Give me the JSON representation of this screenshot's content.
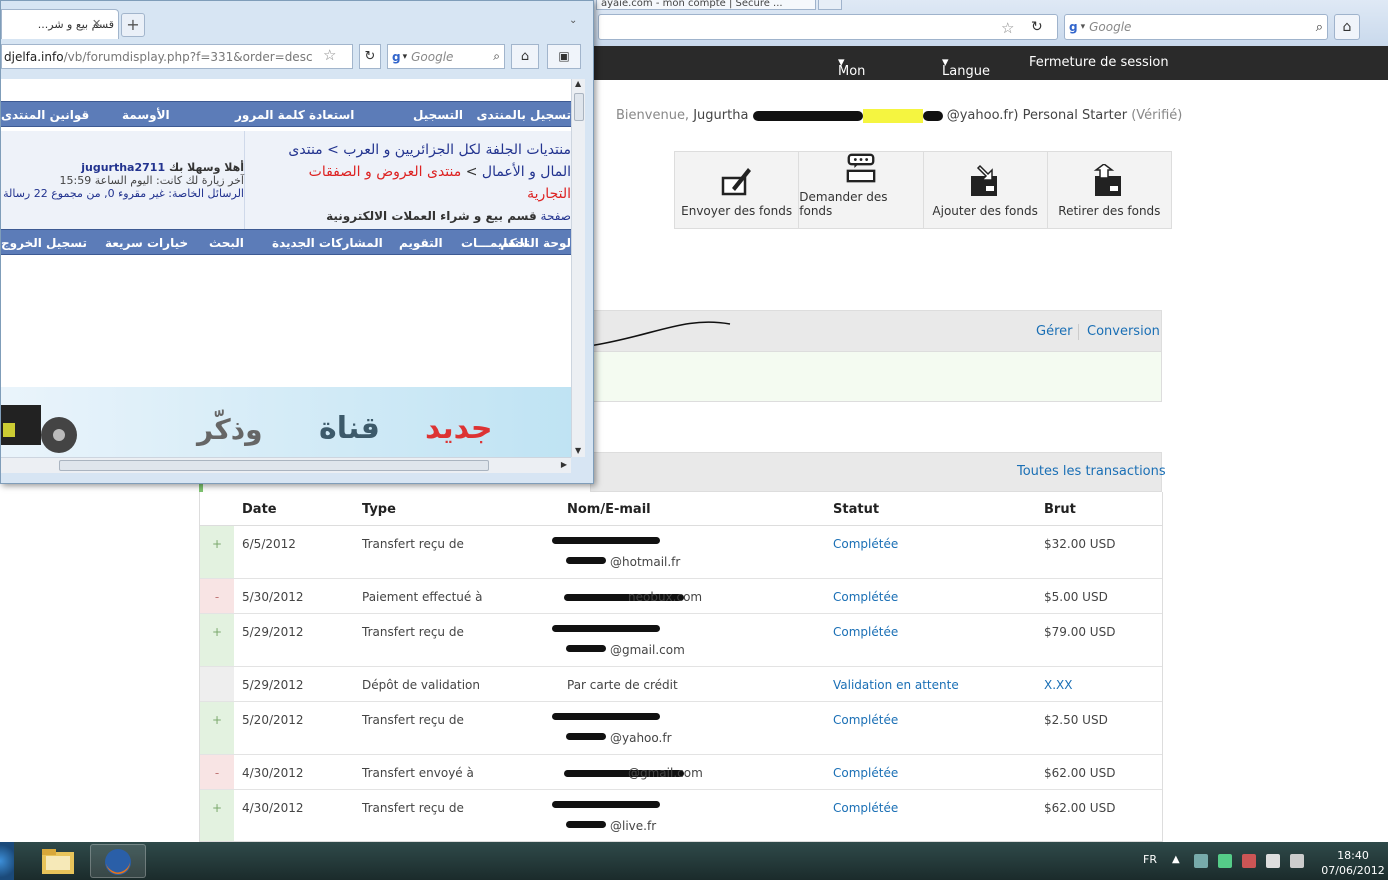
{
  "background_browser": {
    "tab_title": "ayaie.com - mon compte | Sécuré ... ",
    "search_placeholder": "Google",
    "nav": {
      "profile": "Mon profil",
      "language": "Langue",
      "logout": "Fermeture de session"
    },
    "welcome": {
      "prefix": "Bienvenue,",
      "name": "Jugurtha",
      "email_suffix": "@yahoo.fr)",
      "account_type": "Personal Starter",
      "verified": "(Vérifié)"
    },
    "actions": [
      {
        "label": "Envoyer des fonds",
        "icon": "send-funds-icon"
      },
      {
        "label": "Demander des fonds",
        "icon": "request-funds-icon"
      },
      {
        "label": "Ajouter des fonds",
        "icon": "add-funds-icon"
      },
      {
        "label": "Retirer des fonds",
        "icon": "withdraw-funds-icon"
      }
    ],
    "links": {
      "manage": "Gérer",
      "conversion": "Conversion",
      "all_transactions": "Toutes les transactions"
    },
    "table": {
      "headers": [
        "Date",
        "Type",
        "Nom/E-mail",
        "Statut",
        "Brut"
      ],
      "rows": [
        {
          "sign": "+",
          "date": "6/5/2012",
          "type": "Transfert reçu de",
          "email": "@hotmail.fr",
          "status": "Complétée",
          "gross": "$32.00 USD",
          "two_line": true
        },
        {
          "sign": "-",
          "date": "5/30/2012",
          "type": "Paiement effectué à",
          "email": "neobux.com",
          "status": "Complétée",
          "gross": "$5.00 USD",
          "two_line": false
        },
        {
          "sign": "+",
          "date": "5/29/2012",
          "type": "Transfert reçu de",
          "email": "@gmail.com",
          "status": "Complétée",
          "gross": "$79.00 USD",
          "two_line": true
        },
        {
          "sign": "",
          "date": "5/29/2012",
          "type": "Dépôt de validation",
          "email": "Par carte de crédit",
          "status": "Validation en attente",
          "gross": "X.XX",
          "two_line": false
        },
        {
          "sign": "+",
          "date": "5/20/2012",
          "type": "Transfert reçu de",
          "email": "@yahoo.fr",
          "status": "Complétée",
          "gross": "$2.50 USD",
          "two_line": true
        },
        {
          "sign": "-",
          "date": "4/30/2012",
          "type": "Transfert envoyé à",
          "email": "@gmail.com",
          "status": "Complétée",
          "gross": "$62.00 USD",
          "two_line": false
        },
        {
          "sign": "+",
          "date": "4/30/2012",
          "type": "Transfert reçu de",
          "email": "@live.fr",
          "status": "Complétée",
          "gross": "$62.00 USD",
          "two_line": true
        }
      ]
    }
  },
  "foreground_browser": {
    "tab_title": "قسم بيع و شر...",
    "url_domain": "djelfa.info",
    "url_path": "/vb/forumdisplay.php?f=331&order=desc",
    "search_placeholder": "Google",
    "top_nav": [
      "تسجيل بالمنتدى",
      "التسجيل",
      "استعادة كلمة المرور",
      "الأوسمة",
      "قوانين المنتدى"
    ],
    "breadcrumb": {
      "line1": "منتديات الجلفة لكل الجزائريين و العرب > منتدى",
      "line2_a": "المال و الأعمال",
      "line2_b": " > ",
      "line2_c": "منتدى العروض و الصفقات",
      "line3": "التجارية",
      "page_label": "صفحة",
      "forum_title": "قسم بيع و شراء العملات الالكترونية"
    },
    "user_info": {
      "welcome": "أهلا وسهلا بك",
      "username": "jugurtha2711",
      "last_visit": "آخر زيارة لك كانت: اليوم الساعة 15:59",
      "messages": "الرسائل الخاصة: غير مقروء 0, من مجموع 22 رسالة"
    },
    "bottom_nav": [
      "لوحة التحكم",
      "التعليمـــات",
      "التقويم",
      "المشاركات الجديدة",
      "البحث",
      "خيارات سريعة",
      "تسجيل الخروج"
    ],
    "banner": {
      "new": "جديد",
      "channel": "قناة",
      "name": "وذكّر"
    }
  },
  "taskbar": {
    "language": "FR",
    "time": "18:40",
    "date": "07/06/2012"
  }
}
